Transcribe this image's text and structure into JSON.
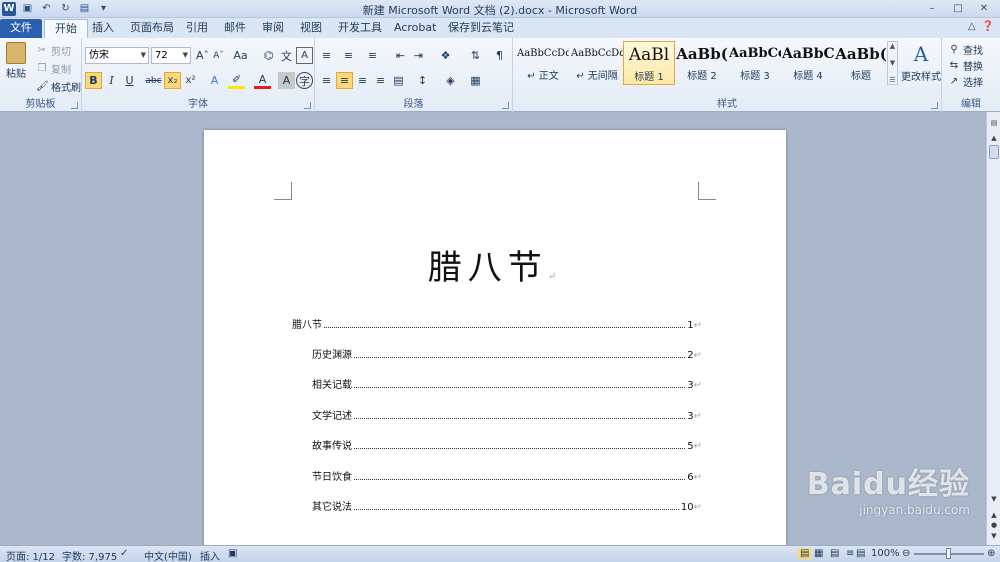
{
  "window": {
    "title": "新建 Microsoft Word 文档 (2).docx - Microsoft Word"
  },
  "tabs": [
    "文件",
    "开始",
    "插入",
    "页面布局",
    "引用",
    "邮件",
    "审阅",
    "视图",
    "开发工具",
    "Acrobat",
    "保存到云笔记"
  ],
  "ribbon": {
    "clipboard": {
      "label": "剪贴板",
      "paste": "粘贴",
      "cut": "剪切",
      "copy": "复制",
      "format_painter": "格式刷"
    },
    "font": {
      "label": "字体",
      "font_name": "仿宋",
      "font_size": "72"
    },
    "paragraph": {
      "label": "段落"
    },
    "styles": {
      "label": "样式",
      "tiles": [
        {
          "sample": "AaBbCcDd",
          "name": "↵ 正文"
        },
        {
          "sample": "AaBbCcDd",
          "name": "↵ 无间隔"
        },
        {
          "sample": "AaBl",
          "name": "标题 1"
        },
        {
          "sample": "AaBb(",
          "name": "标题 2"
        },
        {
          "sample": "AaBbCc",
          "name": "标题 3"
        },
        {
          "sample": "AaBbC(",
          "name": "标题 4"
        },
        {
          "sample": "AaBb(",
          "name": "标题"
        }
      ],
      "change_styles": "更改样式"
    },
    "editing": {
      "label": "编辑",
      "find": "查找",
      "replace": "替换",
      "select": "选择"
    }
  },
  "document": {
    "title": "腊八节",
    "toc": [
      {
        "text": "腊八节",
        "page": "1",
        "level": 1
      },
      {
        "text": "历史渊源",
        "page": "2",
        "level": 2
      },
      {
        "text": "相关记载",
        "page": "3",
        "level": 2
      },
      {
        "text": "文学记述",
        "page": "3",
        "level": 2
      },
      {
        "text": "故事传说",
        "page": "5",
        "level": 2
      },
      {
        "text": "节日饮食",
        "page": "6",
        "level": 2
      },
      {
        "text": "其它说法",
        "page": "10",
        "level": 2
      }
    ],
    "para_mark": "↵"
  },
  "status": {
    "page": "页面: 1/12",
    "words": "字数: 7,975",
    "language": "中文(中国)",
    "mode": "插入",
    "zoom": "100%"
  },
  "watermark": {
    "brand": "Baidu经验",
    "url": "jingyan.baidu.com"
  }
}
